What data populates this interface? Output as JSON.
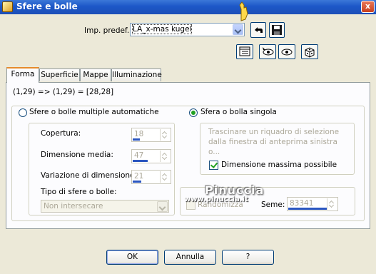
{
  "window": {
    "title": "Sfere e bolle",
    "close_label": "x"
  },
  "preset": {
    "label": "Imp. predef.:",
    "value": "LA_x-mas kugel"
  },
  "tabs": [
    "Forma",
    "Superficie",
    "Mappe",
    "Illuminazione"
  ],
  "formula": "(1,29) => (1,29) = [28,28]",
  "auto": {
    "radio_label": "Sfere o bolle multiple automatiche",
    "coverage": {
      "label": "Copertura:",
      "value": "18"
    },
    "avg_size": {
      "label": "Dimensione media:",
      "value": "47"
    },
    "size_var": {
      "label": "Variazione di dimensione:",
      "value": "21"
    },
    "type_label": "Tipo di sfere o bolle:",
    "type_value": "Non intersecare",
    "randomize_label": "Randomizza",
    "seed_label": "Seme:",
    "seed_value": "83341"
  },
  "single": {
    "radio_label": "Sfera o bolla singola",
    "hint": "Trascinare un riquadro di selezione dalla finestra di anteprima sinistra o...",
    "max_size_label": "Dimensione massima possibile"
  },
  "buttons": {
    "ok": "OK",
    "cancel": "Annulla",
    "help": "?"
  },
  "watermark": {
    "line1": "Pinuccia",
    "line2": "www.pinuccia.it"
  },
  "colors": {
    "titlebar": "#1c57c7",
    "accent": "#21a121",
    "tab_highlight": "#e68b2c"
  }
}
